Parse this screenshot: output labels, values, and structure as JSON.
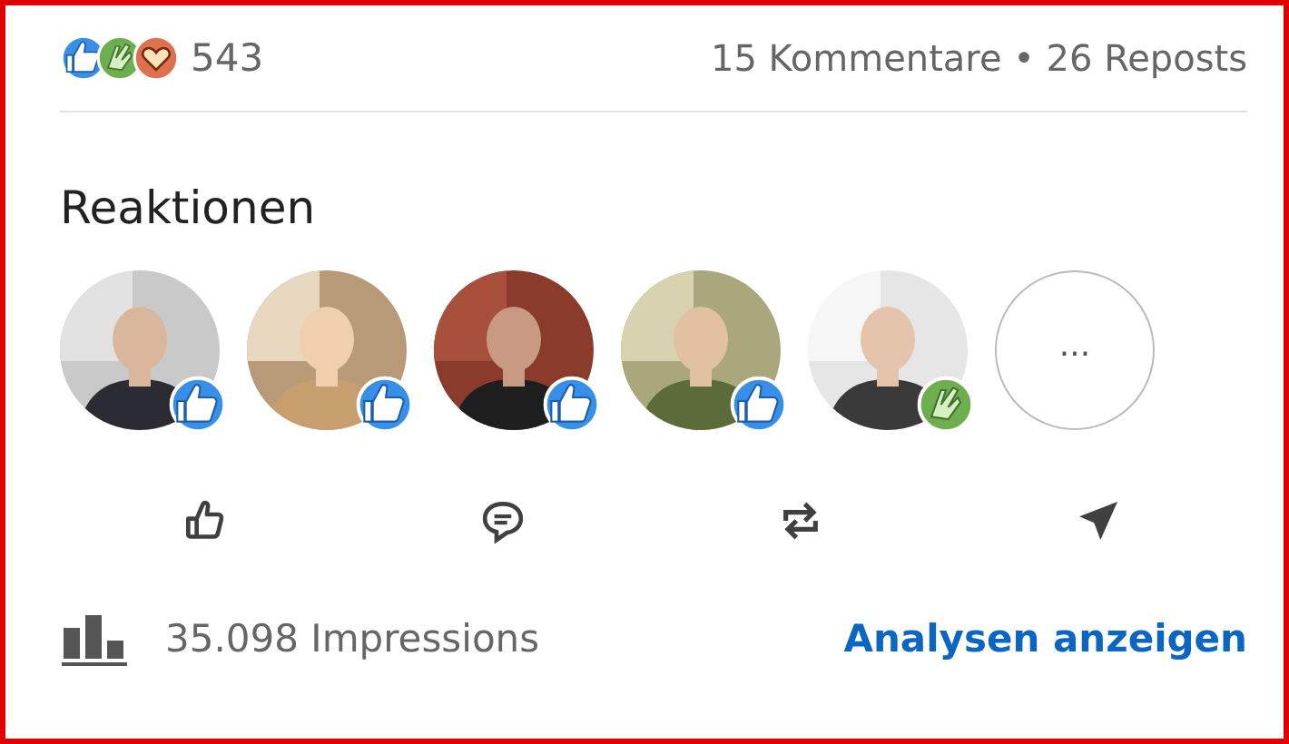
{
  "summary": {
    "reaction_icons": [
      {
        "kind": "like"
      },
      {
        "kind": "clap"
      },
      {
        "kind": "love"
      }
    ],
    "count": "543",
    "engagement": "15 Kommentare • 26 Reposts"
  },
  "reactions": {
    "title": "Reaktionen",
    "people": [
      {
        "kind": "picture",
        "badge": {
          "kind": "like"
        }
      },
      {
        "kind": "picture",
        "badge": {
          "kind": "like"
        }
      },
      {
        "kind": "picture",
        "badge": {
          "kind": "like"
        }
      },
      {
        "kind": "picture",
        "badge": {
          "kind": "like"
        }
      },
      {
        "kind": "picture",
        "badge": {
          "kind": "clap"
        }
      }
    ],
    "more_button": "..."
  },
  "actions": [
    {
      "kind": "like"
    },
    {
      "kind": "comment"
    },
    {
      "kind": "repost"
    },
    {
      "kind": "send"
    }
  ],
  "footer": {
    "impressions": "35.098 Impressions",
    "link": "Analysen anzeigen"
  }
}
